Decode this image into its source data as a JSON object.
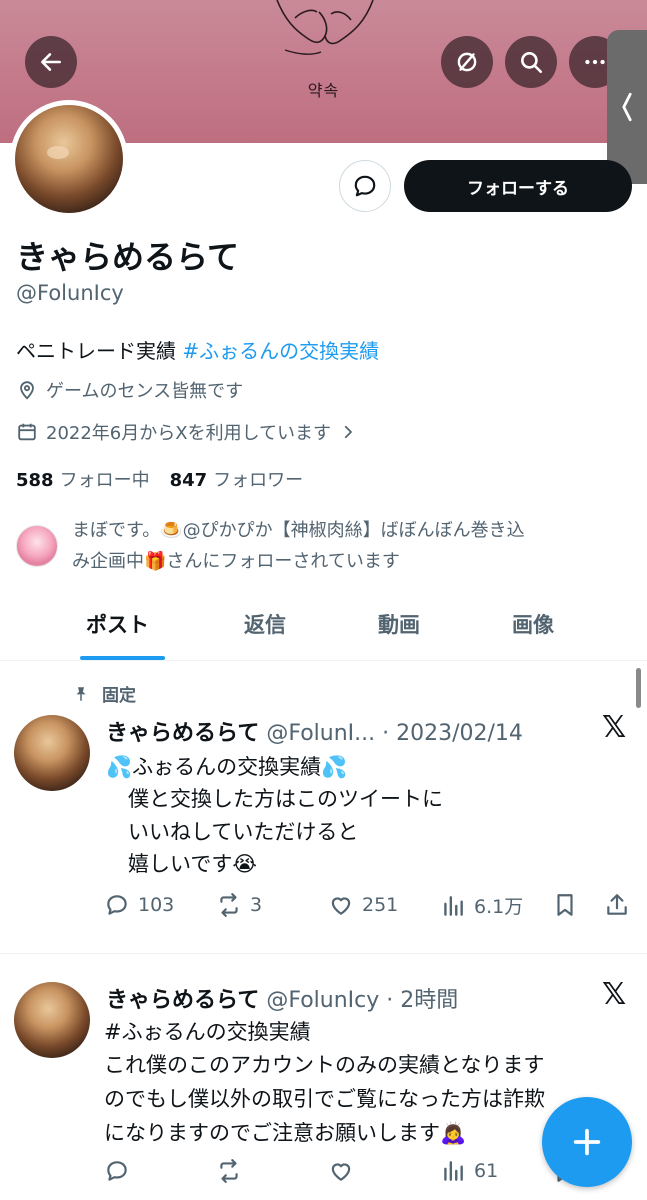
{
  "banner": {
    "text": "약속"
  },
  "profile": {
    "name": "きゃらめるらて",
    "handle": "@FolunIcy",
    "follow_label": "フォローする",
    "bio_text": "ペニトレード実績 ",
    "bio_hashtag": "#ふぉるんの交換実績",
    "location": "ゲームのセンス皆無です",
    "joined": "2022年6月からXを利用しています",
    "following_count": "588",
    "following_label": "フォロー中",
    "followers_count": "847",
    "followers_label": "フォロワー",
    "followed_by_text": "まぼです。🍮@ぴかぴか【神椒肉絲】ばぼんぼん巻き込み企画中🎁さんにフォローされています"
  },
  "tabs": [
    {
      "label": "ポスト",
      "active": true
    },
    {
      "label": "返信",
      "active": false
    },
    {
      "label": "動画",
      "active": false
    },
    {
      "label": "画像",
      "active": false
    }
  ],
  "posts": [
    {
      "pinned_label": "固定",
      "name": "きゃらめるらて",
      "meta": " @FolunI... · 2023/02/14",
      "lines": [
        "💦ふぉるんの交換実績💦",
        "僕と交換した方はこのツイートに",
        "いいねしていただけると",
        "嬉しいです😭"
      ],
      "replies": "103",
      "reposts": "3",
      "likes": "251",
      "views": "6.1万"
    },
    {
      "name": "きゃらめるらて",
      "meta": " @FolunIcy · 2時間",
      "hashtag": "#ふぉるんの交換実績",
      "lines": [
        "これ僕のこのアカウントのみの実績となります",
        "のでもし僕以外の取引でご覧になった方は詐欺",
        "になりますのでご注意お願いします🙇‍♀️"
      ],
      "replies": "",
      "reposts": "",
      "likes": "",
      "views": "61"
    }
  ],
  "icons": {
    "back": "arrow-left-icon",
    "mute": "eye-slash-icon",
    "search": "search-icon",
    "more": "more-icon",
    "message": "message-icon",
    "location": "location-pin-icon",
    "calendar": "calendar-icon",
    "pin": "pin-icon",
    "x": "x-logo-icon",
    "compose": "plus-icon"
  },
  "colors": {
    "accent": "#1d9bf0",
    "banner": "#c47a8a",
    "text": "#0f1419",
    "muted": "#536471"
  }
}
